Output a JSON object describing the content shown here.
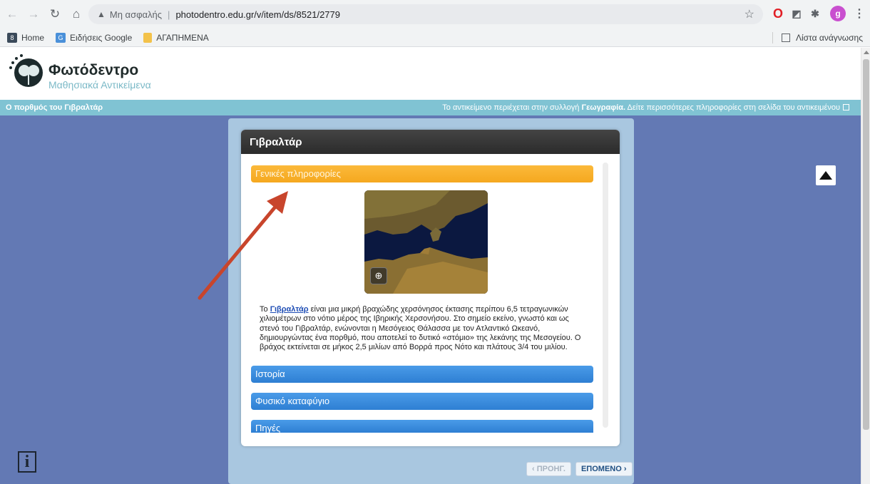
{
  "browser": {
    "back_icon": "arrow-left-icon",
    "forward_icon": "arrow-right-icon",
    "reload_icon": "reload-icon",
    "home_icon": "home-icon",
    "security_label": "Μη ασφαλής",
    "url": "photodentro.edu.gr/v/item/ds/8521/2779",
    "avatar_letter": "g",
    "bookmarks": [
      {
        "label": "Home"
      },
      {
        "label": "Ειδήσεις Google"
      },
      {
        "label": "ΑΓΑΠΗΜΕΝΑ"
      }
    ],
    "reading_list": "Λίστα ανάγνωσης"
  },
  "site": {
    "title": "Φωτόδεντρο",
    "subtitle": "Μαθησιακά Αντικείμενα"
  },
  "info_bar": {
    "left": "Ο πορθμός του Γιβραλτάρ",
    "right_prefix": "Το αντικείμενο περιέχεται στην συλλογή ",
    "collection": "Γεωγραφία.",
    "right_suffix": " Δείτε περισσότερες πληροφορίες στη σελίδα του αντικειμένου"
  },
  "panel": {
    "title": "Γιβραλτάρ",
    "sections": [
      {
        "label": "Γενικές πληροφορίες"
      },
      {
        "label": "Ιστορία"
      },
      {
        "label": "Φυσικό καταφύγιο"
      },
      {
        "label": "Πηγές"
      }
    ],
    "desc_prefix": "Το ",
    "desc_link": "Γιβραλτάρ",
    "desc_text": " είναι μια μικρή βραχώδης χερσόνησος έκτασης περίπου 6,5 τετραγωνικών χιλιομέτρων στο νότιο μέρος της Ιβηρικής Χερσονήσου. Στο σημείο εκείνο, γνωστό και ως στενό του Γιβραλτάρ, ενώνονται η Μεσόγειος Θάλασσα με τον Ατλαντικό Ωκεανό, δημιουργώντας ένα πορθμό, που αποτελεί το δυτικό «στόμιο» της λεκάνης της Μεσογείου. Ο βράχος εκτείνεται σε μήκος 2,5 μιλίων από Βορρά προς Νότο και πλάτους 3/4 του μιλίου."
  },
  "pager": {
    "prev": "‹ ΠΡΟΗΓ.",
    "next": "ΕΠΟΜΕΝΟ ›"
  },
  "info_button": "i",
  "annotation_color": "#c8452c"
}
